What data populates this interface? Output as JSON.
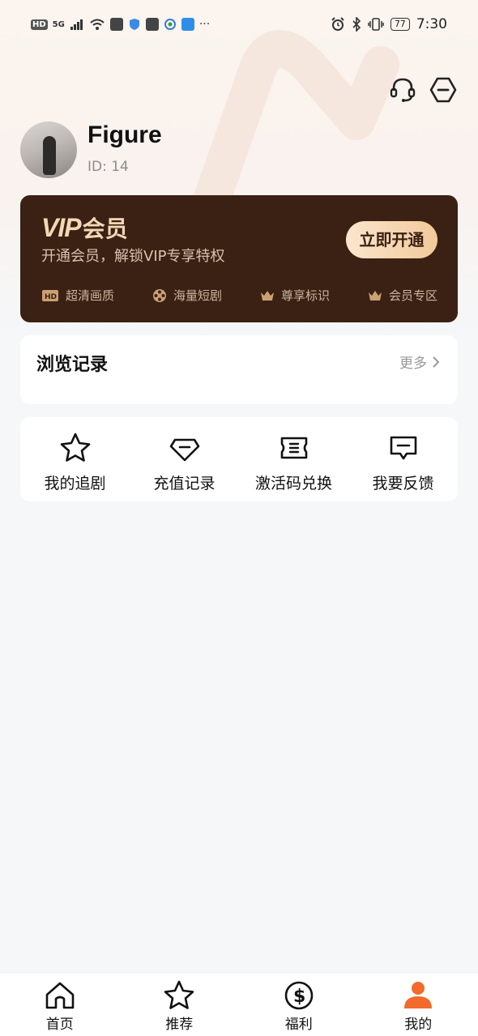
{
  "status_bar": {
    "time": "7:30",
    "battery": "77",
    "network_badge": "HD",
    "network_type": "5G",
    "ellipsis": "···"
  },
  "profile": {
    "username": "Figure",
    "user_id": "ID: 14"
  },
  "vip": {
    "logo": "VIP",
    "title": "会员",
    "subtitle": "开通会员，解锁VIP专享特权",
    "button": "立即开通",
    "perks": [
      "超清画质",
      "海量短剧",
      "尊享标识",
      "会员专区"
    ],
    "colors": {
      "card_bg": "#3a2114",
      "gold": "#f4d7b4"
    }
  },
  "history": {
    "title": "浏览记录",
    "more": "更多"
  },
  "tools": [
    {
      "label": "我的追剧",
      "icon": "star-icon"
    },
    {
      "label": "充值记录",
      "icon": "diamond-icon"
    },
    {
      "label": "激活码兑换",
      "icon": "ticket-icon"
    },
    {
      "label": "我要反馈",
      "icon": "feedback-icon"
    }
  ],
  "bottom_nav": [
    {
      "label": "首页",
      "icon": "home-icon",
      "active": false
    },
    {
      "label": "推荐",
      "icon": "star-icon",
      "active": false
    },
    {
      "label": "福利",
      "icon": "coin-icon",
      "active": false
    },
    {
      "label": "我的",
      "icon": "profile-icon",
      "active": true
    }
  ],
  "accent_color": "#f26a2c"
}
